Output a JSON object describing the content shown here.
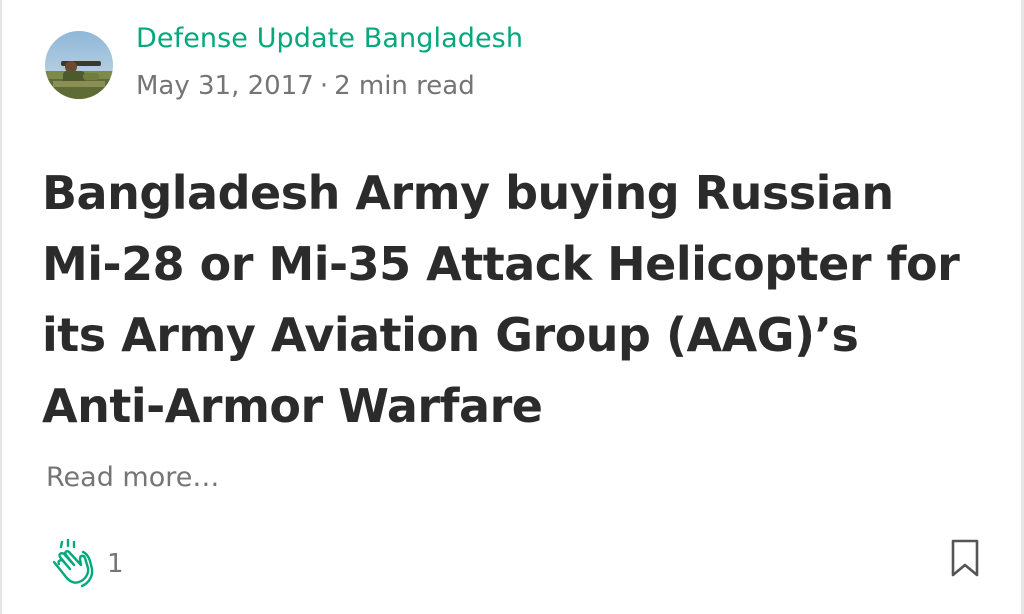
{
  "post": {
    "author_name": "Defense Update Bangladesh",
    "date": "May 31, 2017",
    "separator": "·",
    "read_time": "2 min read",
    "title_lines": [
      "Bangladesh Army buying Russian",
      "Mi-28 or Mi-35 Attack Helicopter for",
      "its Army Aviation Group (AAG)’s",
      "Anti-Armor Warfare"
    ],
    "read_more": "Read more…",
    "clap_count": "1"
  },
  "icons": {
    "avatar": "author-avatar",
    "clap": "clap-icon",
    "bookmark": "bookmark-icon"
  },
  "colors": {
    "accent": "#03a87c",
    "title": "#2b2b2b",
    "meta": "#757575"
  }
}
